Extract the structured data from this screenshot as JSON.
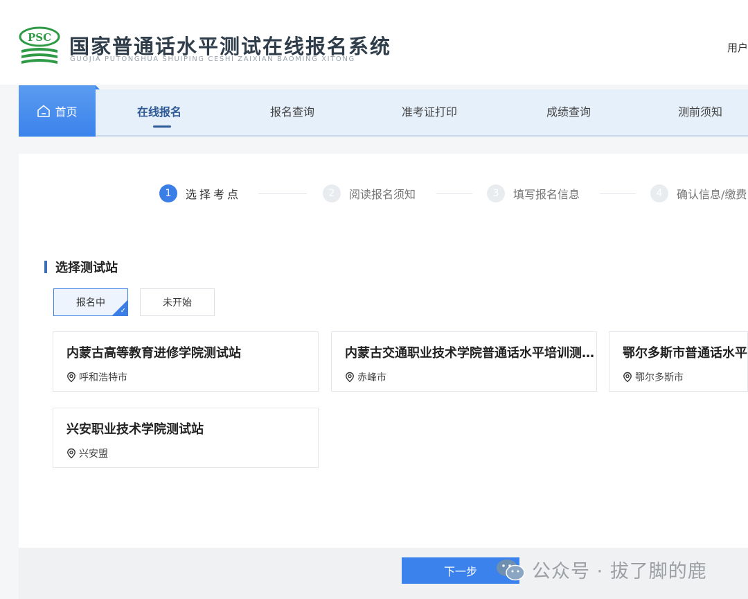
{
  "header": {
    "logo_text": "PSC",
    "title": "国家普通话水平测试在线报名系统",
    "subtitle": "GUOJIA PUTONGHUA SHUIPING CESHI ZAIXIAN BAOMING XITONG",
    "user_link": "用户"
  },
  "nav": {
    "home": "首页",
    "items": [
      "在线报名",
      "报名查询",
      "准考证打印",
      "成绩查询",
      "测前须知"
    ],
    "active_index": 0
  },
  "steps": [
    {
      "number": "1",
      "label": "选择考点",
      "active": true
    },
    {
      "number": "2",
      "label": "阅读报名须知",
      "active": false
    },
    {
      "number": "3",
      "label": "填写报名信息",
      "active": false
    },
    {
      "number": "4",
      "label": "确认信息/缴费",
      "active": false
    }
  ],
  "section": {
    "title": "选择测试站"
  },
  "filters": [
    {
      "label": "报名中",
      "selected": true
    },
    {
      "label": "未开始",
      "selected": false
    }
  ],
  "stations": [
    {
      "name": "内蒙古高等教育进修学院测试站",
      "city": "呼和浩特市"
    },
    {
      "name": "内蒙古交通职业技术学院普通话水平培训测试站",
      "city": "赤峰市"
    },
    {
      "name": "鄂尔多斯市普通话水平测试站",
      "city": "鄂尔多斯市"
    },
    {
      "name": "兴安职业技术学院测试站",
      "city": "兴安盟"
    }
  ],
  "footer": {
    "next_label": "下一步"
  },
  "watermark": {
    "text": "公众号 · 拔了脚的鹿"
  },
  "colors": {
    "primary": "#3b82ec",
    "nav_bg": "#e6f0fb",
    "title": "#2f3d4a",
    "psc_green": "#2e9a45"
  }
}
